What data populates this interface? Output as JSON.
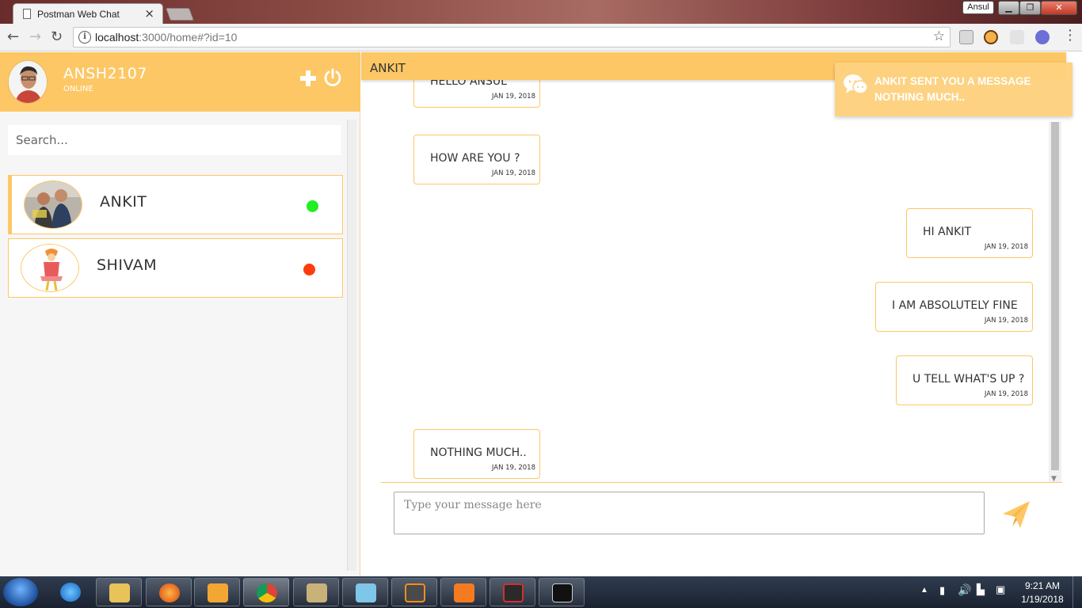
{
  "browser": {
    "tab_title": "Postman Web Chat",
    "tab_close": "×",
    "url_host": "localhost",
    "url_path": ":3000/home#?id=10",
    "window_user": "Ansul"
  },
  "profile": {
    "username": "ANSH2107",
    "status": "ONLINE"
  },
  "search": {
    "placeholder": "Search..."
  },
  "contacts": [
    {
      "name": "ANKIT",
      "online": true,
      "status_color": "#22ee22"
    },
    {
      "name": "SHIVAM",
      "online": false,
      "status_color": "#ff3b0f"
    }
  ],
  "chat": {
    "header_name": "ANKIT",
    "messages": [
      {
        "text": "HELLO ANSUL",
        "time": "JAN 19, 2018",
        "side": "left"
      },
      {
        "text": "HOW ARE YOU ?",
        "time": "JAN 19, 2018",
        "side": "left"
      },
      {
        "text": "HI ANKIT",
        "time": "JAN 19, 2018",
        "side": "right"
      },
      {
        "text": "I AM ABSOLUTELY FINE",
        "time": "JAN 19, 2018",
        "side": "right"
      },
      {
        "text": "U TELL WHAT'S UP ?",
        "time": "JAN 19, 2018",
        "side": "right"
      },
      {
        "text": "NOTHING MUCH..",
        "time": "JAN 19, 2018",
        "side": "left"
      }
    ],
    "input_placeholder": "Type your message here"
  },
  "notification": {
    "title": "ANKIT SENT YOU A MESSAGE",
    "body": "NOTHING MUCH.."
  },
  "taskbar": {
    "time": "9:21 AM",
    "date": "1/19/2018"
  },
  "colors": {
    "accent": "#fdc765",
    "online": "#22ee22",
    "offline": "#ff3b0f"
  }
}
